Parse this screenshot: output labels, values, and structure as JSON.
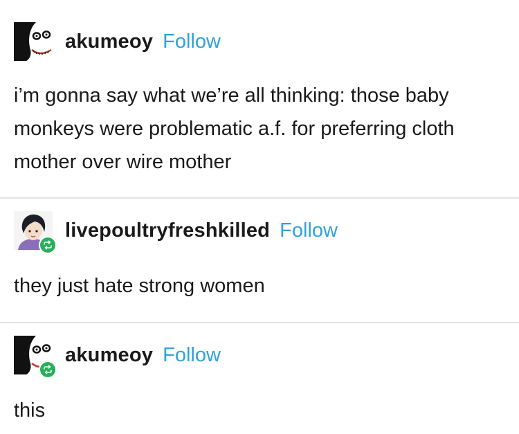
{
  "posts": [
    {
      "username": "akumeoy",
      "follow_label": "Follow",
      "avatar_icon": "creepy-face-avatar-icon",
      "reblog": false,
      "body": "i’m gonna say what we’re all thinking: those baby monkeys were problematic a.f. for preferring cloth mother over wire mother"
    },
    {
      "username": "livepoultryfreshkilled",
      "follow_label": "Follow",
      "avatar_icon": "anime-character-avatar-icon",
      "reblog": true,
      "body": "they just hate strong women"
    },
    {
      "username": "akumeoy",
      "follow_label": "Follow",
      "avatar_icon": "creepy-face-avatar-icon",
      "reblog": true,
      "body": "this"
    }
  ],
  "colors": {
    "follow": "#2fa2dc",
    "reblog_badge": "#26b05a",
    "divider": "#e2e2e2",
    "text": "#1a1a1a"
  }
}
